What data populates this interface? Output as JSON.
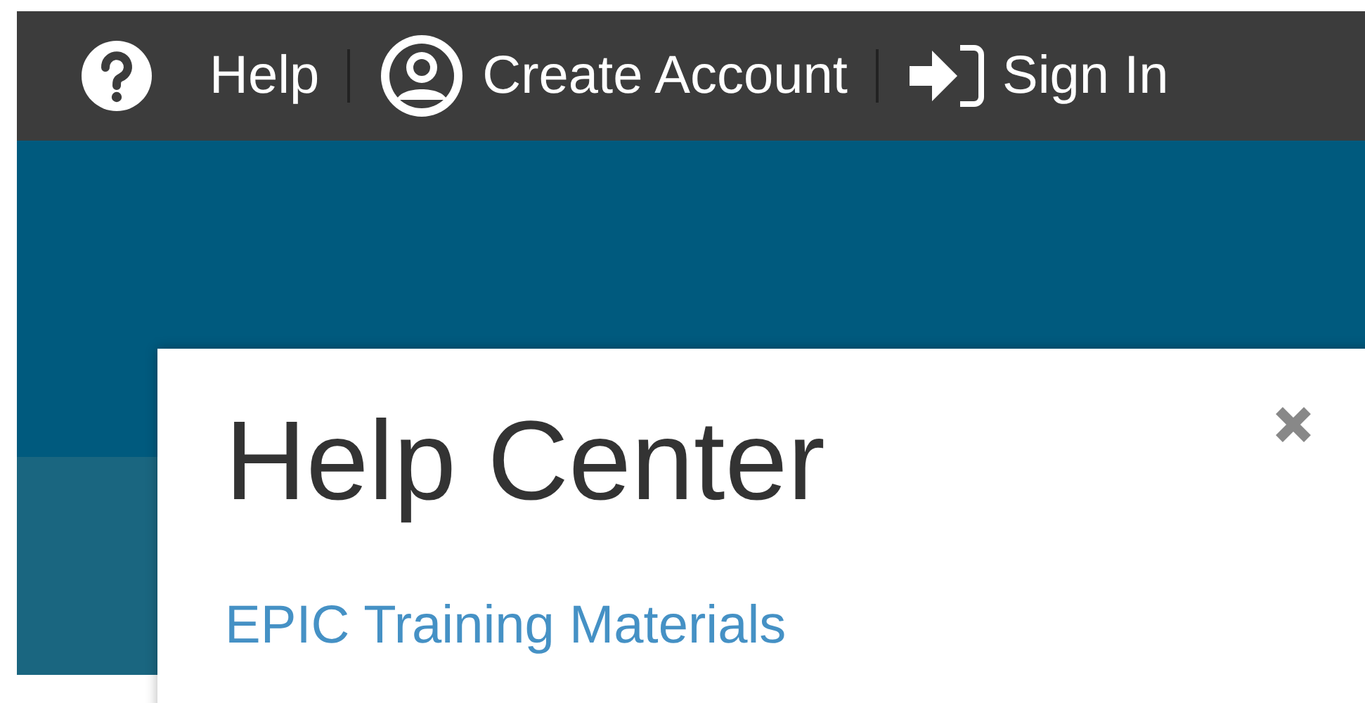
{
  "top_nav": [
    {
      "kind": "help",
      "label": "Help"
    },
    {
      "kind": "account",
      "label": "Create Account"
    },
    {
      "kind": "signin",
      "label": "Sign In"
    }
  ],
  "dialog": {
    "title": "Help Center",
    "links": [
      "EPIC Training Materials"
    ]
  }
}
